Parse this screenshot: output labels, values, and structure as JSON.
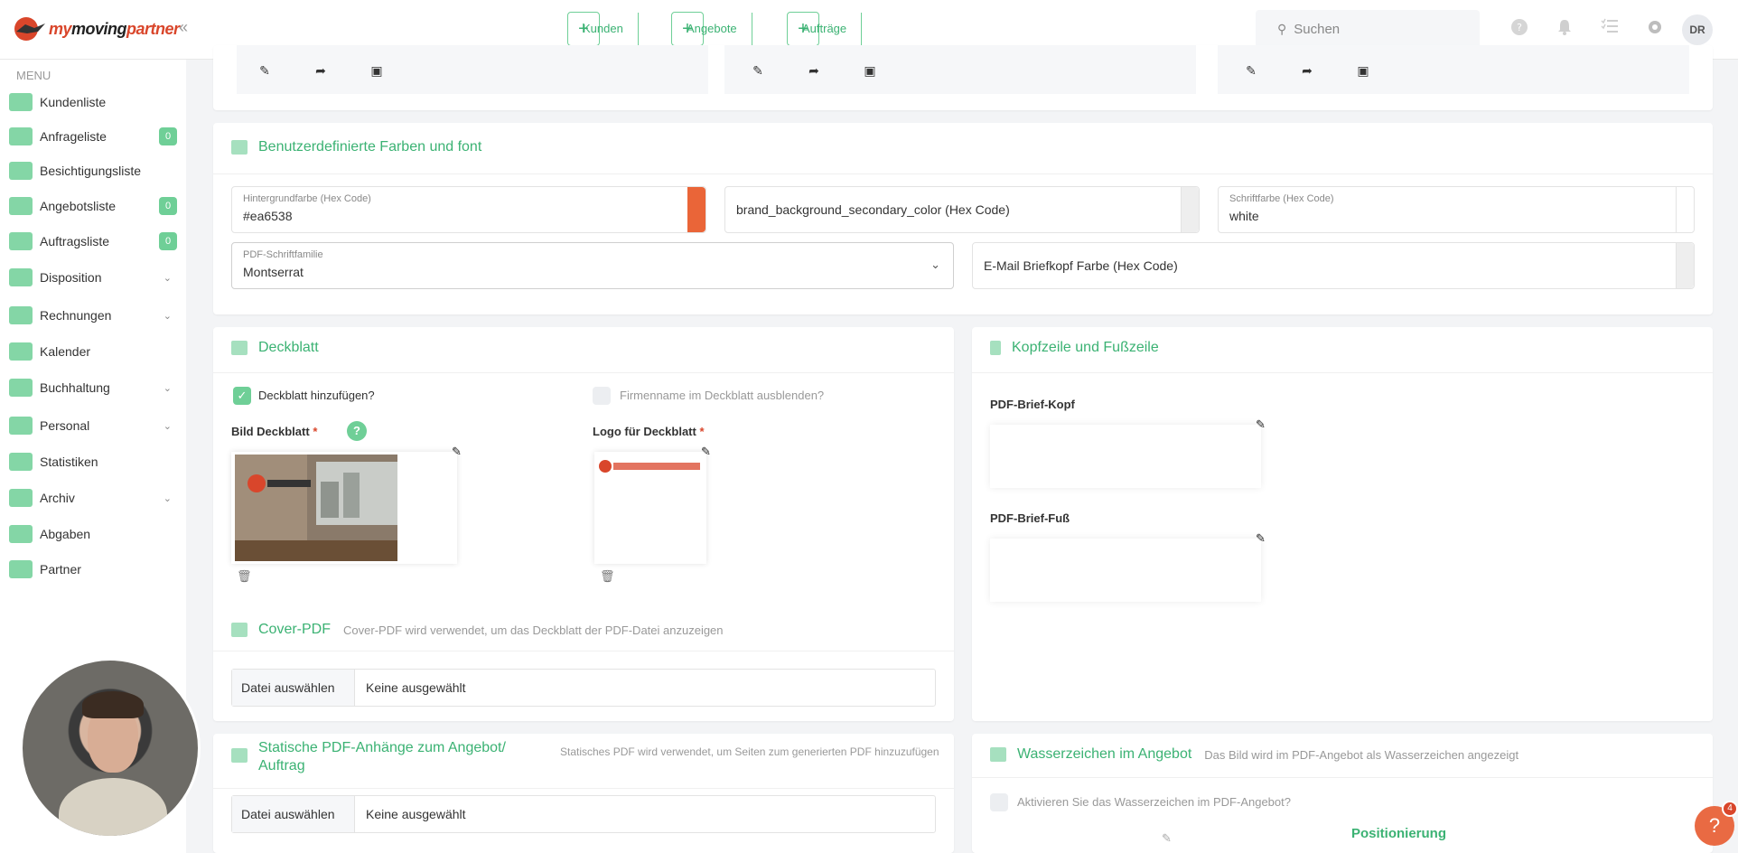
{
  "brand": {
    "logo_prefix": "my",
    "logo_mid": "moving",
    "logo_suffix": "partner"
  },
  "topbar": {
    "collapse_icon": "«",
    "quick": [
      {
        "label": "Kunden"
      },
      {
        "label": "Angebote"
      },
      {
        "label": "Aufträge"
      }
    ],
    "search_placeholder": "Suchen",
    "avatar": "DR"
  },
  "sidebar": {
    "menu_title": "MENU",
    "items": [
      {
        "label": "Kundenliste"
      },
      {
        "label": "Anfrageliste",
        "badge": "0"
      },
      {
        "label": "Besichtigungsliste"
      },
      {
        "label": "Angebotsliste",
        "badge": "0"
      },
      {
        "label": "Auftragsliste",
        "badge": "0"
      },
      {
        "label": "Disposition"
      },
      {
        "label": "Rechnungen"
      },
      {
        "label": "Kalender"
      },
      {
        "label": "Buchhaltung"
      },
      {
        "label": "Personal"
      },
      {
        "label": "Statistiken"
      },
      {
        "label": "Archiv"
      },
      {
        "label": "Abgaben"
      },
      {
        "label": "Partner"
      }
    ]
  },
  "colors_section": {
    "title": "Benutzerdefinierte Farben und font",
    "bg_label": "Hintergrundfarbe (Hex Code)",
    "bg_value": "#ea6538",
    "bg_color": "#ea6538",
    "secondary_placeholder": "brand_background_secondary_color (Hex Code)",
    "font_color_label": "Schriftfarbe (Hex Code)",
    "font_color_value": "white",
    "pdf_font_label": "PDF-Schriftfamilie",
    "pdf_font_value": "Montserrat",
    "email_header_placeholder": "E-Mail Briefkopf Farbe (Hex Code)"
  },
  "cover": {
    "title": "Deckblatt",
    "add_label": "Deckblatt hinzufügen?",
    "hide_label": "Firmenname im Deckblatt ausblenden?",
    "image_label": "Bild Deckblatt",
    "logo_label": "Logo für Deckblatt",
    "required_mark": "*",
    "help": "?"
  },
  "cover_pdf": {
    "title": "Cover-PDF",
    "subtitle": "Cover-PDF wird verwendet, um das Deckblatt der PDF-Datei anzuzeigen",
    "button": "Datei auswählen",
    "value": "Keine ausgewählt"
  },
  "static_pdf": {
    "title": "Statische PDF-Anhänge zum Angebot/ Auftrag",
    "subtitle": "Statisches PDF wird verwendet, um Seiten zum generierten PDF hinzuzufügen",
    "button": "Datei auswählen",
    "value": "Keine ausgewählt"
  },
  "header_footer": {
    "title": "Kopfzeile und Fußzeile",
    "head_label": "PDF-Brief-Kopf",
    "foot_label": "PDF-Brief-Fuß"
  },
  "watermark": {
    "title": "Wasserzeichen im Angebot",
    "subtitle": "Das Bild wird im PDF-Angebot als Wasserzeichen angezeigt",
    "activate_label": "Aktivieren Sie das Wasserzeichen im PDF-Angebot?",
    "positioning": "Positionierung"
  },
  "help_fab": {
    "icon": "?",
    "count": "4"
  }
}
